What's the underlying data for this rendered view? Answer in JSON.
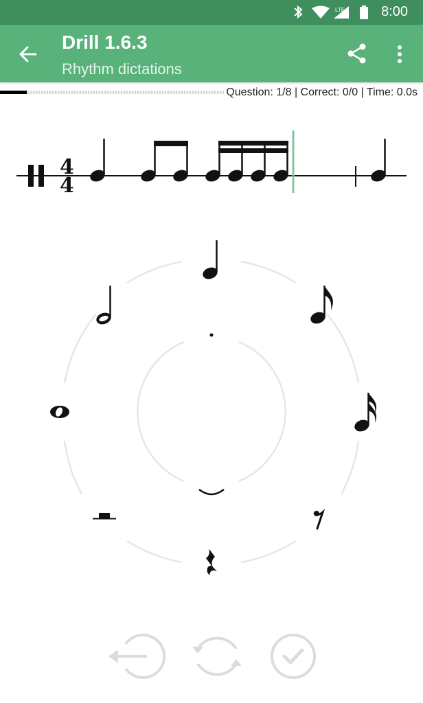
{
  "status_bar": {
    "time": "8:00",
    "network": "LTE",
    "icons": [
      "bluetooth-icon",
      "wifi-icon",
      "signal-icon",
      "battery-icon"
    ]
  },
  "app_bar": {
    "title": "Drill 1.6.3",
    "subtitle": "Rhythm dictations",
    "background_color": "#58b27a",
    "status_color": "#3f8e5d",
    "icons": [
      "back-arrow-icon",
      "share-icon",
      "more-vert-icon"
    ]
  },
  "progress": {
    "fraction": 0.12,
    "question_text": "Question: 1/8",
    "correct_text": "Correct: 0/0",
    "time_text": "Time: 0.0s",
    "separator": " | "
  },
  "staff": {
    "time_signature": {
      "top": "4",
      "bottom": "4"
    },
    "measure_notes": [
      "quarter",
      "eighth",
      "eighth",
      "sixteenth",
      "sixteenth",
      "sixteenth",
      "sixteenth"
    ],
    "cursor_color": "#7fc79d",
    "next_measure_notes": [
      "quarter"
    ]
  },
  "wheel": {
    "options": [
      "quarter-note",
      "eighth-note",
      "sixteenth-note",
      "eighth-rest",
      "quarter-rest",
      "half-rest",
      "whole-note",
      "half-note"
    ],
    "modifiers": [
      "dot",
      "tie"
    ]
  },
  "bottom_actions": [
    "backspace-button",
    "replay-button",
    "check-button"
  ]
}
